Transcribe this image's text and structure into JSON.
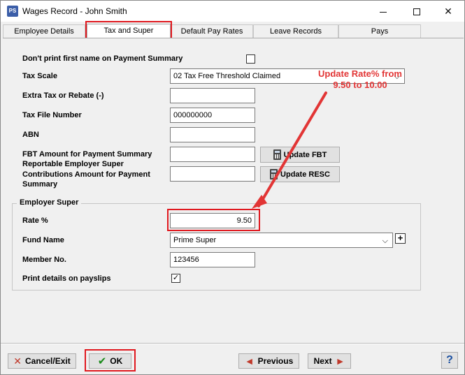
{
  "window": {
    "title": "Wages Record - John Smith",
    "icon": "ps-app-icon",
    "icon_text": "PS"
  },
  "tabs": [
    {
      "label": "Employee Details"
    },
    {
      "label": "Tax and Super",
      "active": true
    },
    {
      "label": "Default Pay Rates"
    },
    {
      "label": "Leave Records"
    },
    {
      "label": "Pays"
    }
  ],
  "form": {
    "dont_print_first_name": {
      "label": "Don't print first name on Payment Summary",
      "checked": false
    },
    "tax_scale": {
      "label": "Tax Scale",
      "value": "02 Tax Free Threshold Claimed"
    },
    "extra_tax": {
      "label": "Extra Tax or Rebate (-)",
      "value": ""
    },
    "tax_file_number": {
      "label": "Tax File Number",
      "value": "000000000"
    },
    "abn": {
      "label": "ABN",
      "value": ""
    },
    "fbt": {
      "label": "FBT Amount for Payment Summary",
      "value": "",
      "button": "Update FBT"
    },
    "resc": {
      "label_line1": "Reportable Employer Super",
      "label_line2": "Contributions Amount for Payment",
      "label_line3": "Summary",
      "value": "",
      "button": "Update RESC"
    }
  },
  "employer_super": {
    "group_title": "Employer Super",
    "rate": {
      "label": "Rate %",
      "value": "9.50"
    },
    "fund_name": {
      "label": "Fund Name",
      "value": "Prime Super"
    },
    "member_no": {
      "label": "Member No.",
      "value": "123456"
    },
    "print_details": {
      "label": "Print details on payslips",
      "checked": true
    }
  },
  "annotation": {
    "line1": "Update Rate% from",
    "line2": "9.50 to 10.00",
    "color": "#e23535"
  },
  "footer": {
    "cancel": "Cancel/Exit",
    "ok": "OK",
    "previous": "Previous",
    "next": "Next",
    "help": "?"
  },
  "colors": {
    "highlight": "#e0191f"
  }
}
